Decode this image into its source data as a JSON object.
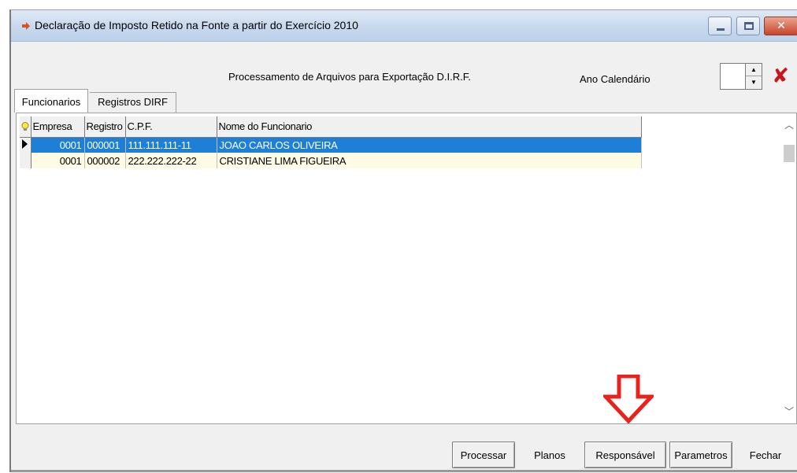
{
  "window": {
    "title": "Declaração de Imposto Retido na Fonte a partir do Exercício 2010"
  },
  "header": {
    "process_title": "Processamento de Arquivos para Exportação D.I.R.F.",
    "ano_label": "Ano Calendário",
    "ano_value": ""
  },
  "tabs": [
    {
      "label": "Funcionarios",
      "active": true
    },
    {
      "label": "Registros DIRF",
      "active": false
    }
  ],
  "grid": {
    "columns": [
      "Empresa",
      "Registro",
      "C.P.F.",
      "Nome do Funcionario"
    ],
    "rows": [
      {
        "empresa": "0001",
        "registro": "000001",
        "cpf": "111.111.111-11",
        "nome": "JOAO CARLOS OLIVEIRA",
        "selected": true
      },
      {
        "empresa": "0001",
        "registro": "000002",
        "cpf": "222.222.222-22",
        "nome": "CRISTIANE LIMA FIGUEIRA",
        "selected": false
      }
    ]
  },
  "buttons": {
    "processar": "Processar",
    "planos": "Planos",
    "responsavel": "Responsável",
    "parametros": "Parametros",
    "fechar": "Fechar"
  },
  "icons": {
    "app": "arrow-icon",
    "clear": "red-x-icon",
    "grid_header": "lightbulb-icon",
    "row_indicator": "row-pointer-icon"
  },
  "colors": {
    "selection": "#1e7fd6",
    "row_background": "#fdfbe3",
    "annotation": "#e8231d",
    "clear_icon": "#c8151b"
  }
}
